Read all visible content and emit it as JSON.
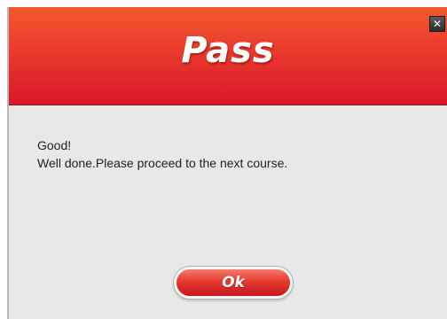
{
  "dialog": {
    "title": "Pass",
    "close_icon": "close-x-icon",
    "message_line1": "Good!",
    "message_line2": "Well done.Please proceed to the next course.",
    "ok_label": "Ok"
  },
  "colors": {
    "header_top": "#f25a2e",
    "header_bottom": "#d9182a",
    "body_background": "#e8e8e8",
    "button_red": "#e43a30"
  }
}
